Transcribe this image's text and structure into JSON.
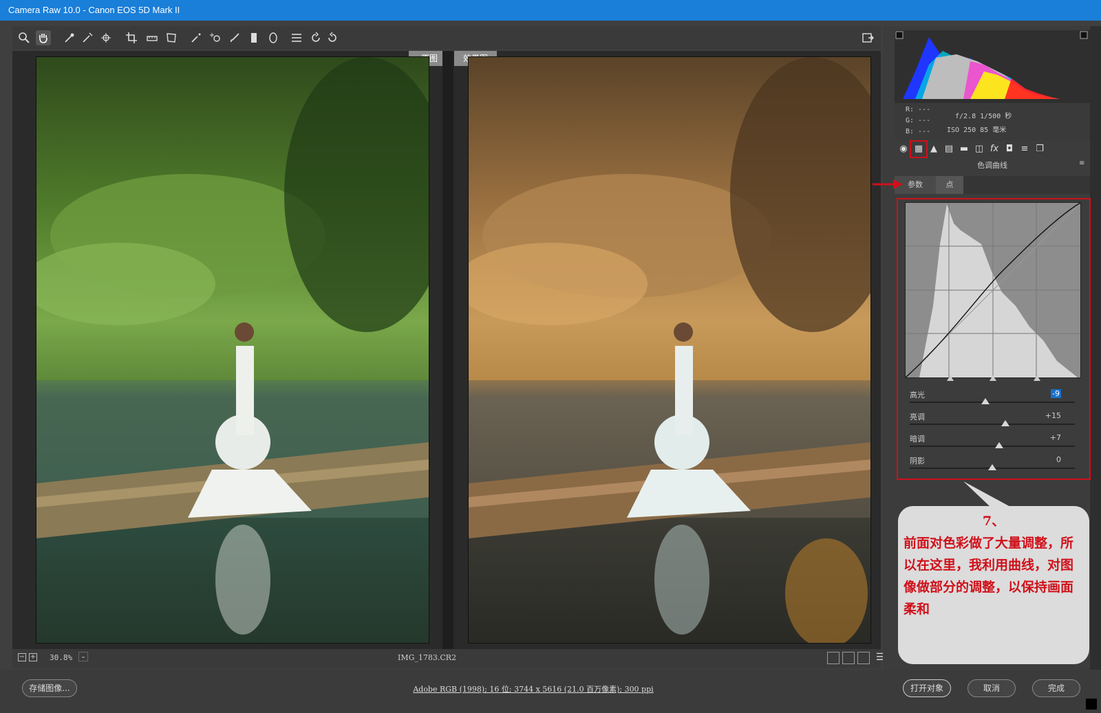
{
  "window": {
    "title": "Camera Raw 10.0 -  Canon EOS 5D Mark II"
  },
  "preview": {
    "tab_before": "原图",
    "tab_after": "效果图",
    "zoom": "30.8%",
    "filename": "IMG_1783.CR2"
  },
  "readout": {
    "r": "R:  ---",
    "g": "G:  ---",
    "b": "B:  ---",
    "exposure": "f/2.8   1/500 秒",
    "iso": "ISO 250   85 毫米"
  },
  "panel": {
    "title": "色调曲线",
    "tab_parametric": "参数",
    "tab_point": "点"
  },
  "sliders": [
    {
      "label": "高光",
      "value": "-9",
      "level": 0.46
    },
    {
      "label": "亮调",
      "value": "+15",
      "level": 0.58
    },
    {
      "label": "暗调",
      "value": "+7",
      "level": 0.54
    },
    {
      "label": "阴影",
      "value": "0",
      "level": 0.5
    }
  ],
  "annotation": {
    "number": "7、",
    "text": "前面对色彩做了大量调整，所以在这里，我利用曲线，对图像做部分的调整，以保持画面柔和"
  },
  "bottom": {
    "save_label": "存储图像...",
    "info": "Adobe RGB (1998); 16 位; 3744 x 5616 (21.0 百万像素); 300 ppi",
    "open_label": "打开对象",
    "cancel_label": "取消",
    "done_label": "完成"
  },
  "colors": {
    "titlebar": "#1a7fd9",
    "accent_red": "#d0101a",
    "panel_bg": "#3c3c3c"
  }
}
